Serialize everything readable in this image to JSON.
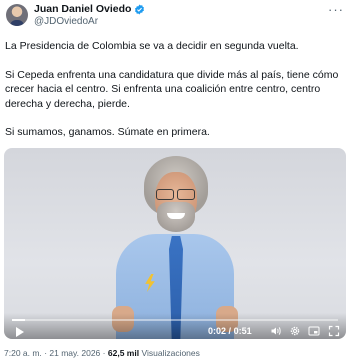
{
  "author": {
    "name": "Juan Daniel Oviedo",
    "handle": "@JDOviedoAr",
    "verified_color": "#1d9bf0"
  },
  "menu_icon": "more-horizontal-icon",
  "post": {
    "paragraphs": [
      "La Presidencia de Colombia se va a decidir en segunda vuelta.",
      "Si Cepeda enfrenta una candidatura que divide más al país, tiene cómo crecer hacia el centro. Si enfrenta una coalición entre centro, centro derecha y derecha, pierde.",
      "Si sumamos, ganamos. Súmate en primera."
    ]
  },
  "video": {
    "current_time": "0:02",
    "separator": "/",
    "duration": "0:51",
    "progress_fraction": 0.04
  },
  "meta": {
    "time": "7:20 a. m.",
    "dot": "·",
    "date": "21 may. 2026",
    "views_count": "62,5 mil",
    "views_label": "Visualizaciones"
  }
}
